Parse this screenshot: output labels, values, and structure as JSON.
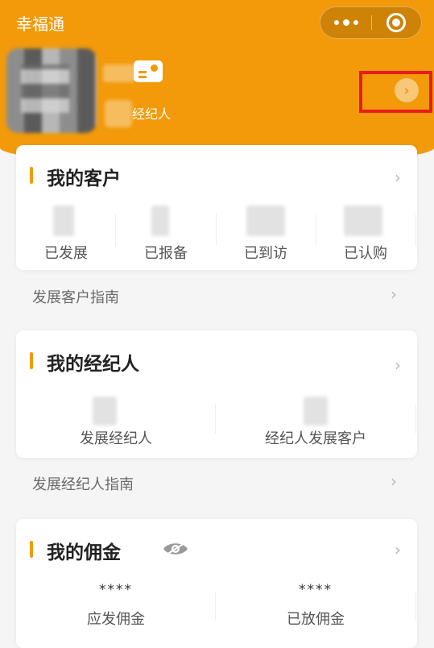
{
  "app": {
    "title": "幸福通"
  },
  "profile": {
    "role_label": "经纪人"
  },
  "my_customers": {
    "title": "我的客户",
    "stats": [
      {
        "label": "已发展"
      },
      {
        "label": "已报备"
      },
      {
        "label": "已到访"
      },
      {
        "label": "已认购"
      }
    ]
  },
  "customer_guide": {
    "label": "发展客户指南"
  },
  "my_agents": {
    "title": "我的经纪人",
    "stats": [
      {
        "label": "发展经纪人"
      },
      {
        "label": "经纪人发展客户"
      }
    ]
  },
  "agent_guide": {
    "label": "发展经纪人指南"
  },
  "my_commission": {
    "title": "我的佣金",
    "stats": [
      {
        "value": "****",
        "label": "应发佣金"
      },
      {
        "value": "****",
        "label": "已放佣金"
      }
    ]
  },
  "icons": {
    "more": "more-dots-icon",
    "close": "capsule-close-icon",
    "card": "id-card-icon",
    "arrow": "chevron-right-icon",
    "eye": "eye-hide-icon"
  },
  "colors": {
    "brand": "#f29a0a",
    "highlight": "#e81c1c"
  }
}
